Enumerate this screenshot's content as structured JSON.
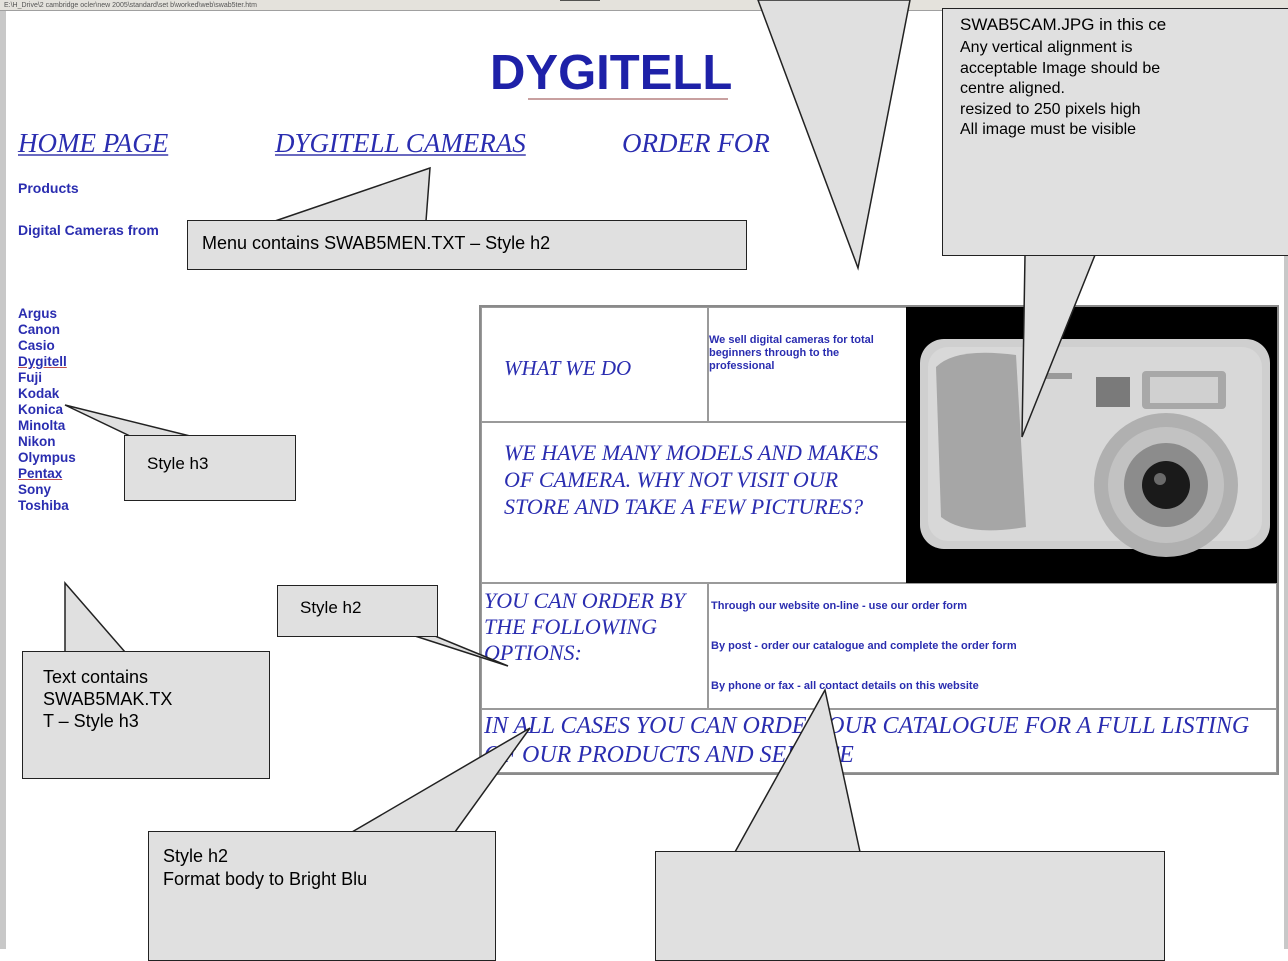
{
  "address_bar": "E:\\H_Drive\\2 cambridge ocler\\new 2005\\standard\\set b\\worked\\web\\swab5ter.htm",
  "logo": "DYGITELL",
  "menu": {
    "home": "HOME PAGE",
    "cameras": "DYGITELL CAMERAS",
    "order": "ORDER FOR"
  },
  "products_heading": "Products",
  "intro_text": "Digital Cameras from",
  "makes": [
    "Argus",
    "Canon",
    "Casio",
    "Dygitell",
    "Fuji",
    "Kodak",
    "Konica",
    "Minolta",
    "Nikon",
    "Olympus",
    "Pentax",
    "Sony",
    "Toshiba"
  ],
  "table": {
    "what_we_do": "WHAT WE DO",
    "what_we_do_text": "We sell digital cameras for total beginners through to the professional",
    "many_models": "WE HAVE MANY MODELS AND MAKES OF CAMERA. WHY NOT VISIT OUR STORE AND TAKE A FEW PICTURES?",
    "order_options": "YOU CAN ORDER BY THE FOLLOWING OPTIONS:",
    "option_1": "Through our website on-line - use our order form",
    "option_2": "By post - order our catalogue and complete the order form",
    "option_3": "By phone or fax - all contact details on this website",
    "footer": "IN ALL CASES YOU CAN ORDER OUR CATALOGUE FOR A FULL LISTING OF OUR PRODUCTS AND SERVICE"
  },
  "callouts": {
    "image_title": "SWAB5CAM.JPG in this ce",
    "image_lines": [
      "Any vertical alignment is",
      "acceptable Image should be",
      "centre aligned.",
      "resized to 250 pixels high",
      "All image must be visible"
    ],
    "menu_note": "Menu contains SWAB5MEN.TXT – Style h2",
    "style_h3": "Style h3",
    "style_h2": "Style h2",
    "text_contains": [
      "Text contains",
      "SWAB5MAK.TX",
      "T – Style h3"
    ],
    "style_h2_bottom": "Style h2",
    "style_h2_bottom_sub": "Format body to Bright Blu"
  },
  "colors": {
    "brand_blue": "#1e21a8",
    "text_blue": "#2a2db0",
    "callout_fill": "#e0e0e0"
  }
}
